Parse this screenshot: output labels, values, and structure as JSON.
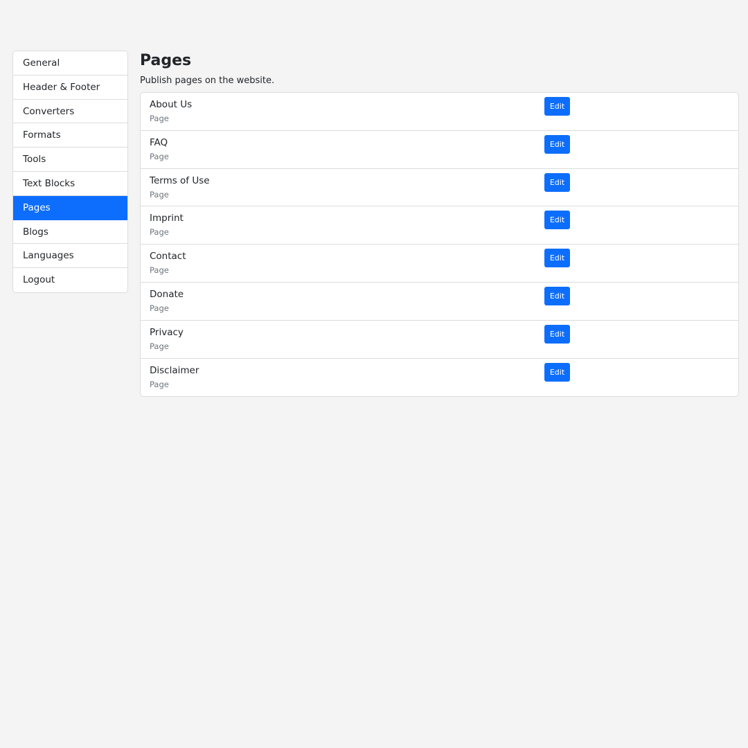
{
  "sidebar": {
    "items": [
      {
        "label": "General",
        "active": false
      },
      {
        "label": "Header & Footer",
        "active": false
      },
      {
        "label": "Converters",
        "active": false
      },
      {
        "label": "Formats",
        "active": false
      },
      {
        "label": "Tools",
        "active": false
      },
      {
        "label": "Text Blocks",
        "active": false
      },
      {
        "label": "Pages",
        "active": true
      },
      {
        "label": "Blogs",
        "active": false
      },
      {
        "label": "Languages",
        "active": false
      },
      {
        "label": "Logout",
        "active": false
      }
    ]
  },
  "main": {
    "title": "Pages",
    "subtitle": "Publish pages on the website.",
    "edit_label": "Edit",
    "pages": [
      {
        "name": "About Us",
        "type": "Page"
      },
      {
        "name": "FAQ",
        "type": "Page"
      },
      {
        "name": "Terms of Use",
        "type": "Page"
      },
      {
        "name": "Imprint",
        "type": "Page"
      },
      {
        "name": "Contact",
        "type": "Page"
      },
      {
        "name": "Donate",
        "type": "Page"
      },
      {
        "name": "Privacy",
        "type": "Page"
      },
      {
        "name": "Disclaimer",
        "type": "Page"
      }
    ]
  },
  "colors": {
    "accent": "#0d6efd",
    "background": "#f4f4f4",
    "muted_text": "#6c757d"
  }
}
